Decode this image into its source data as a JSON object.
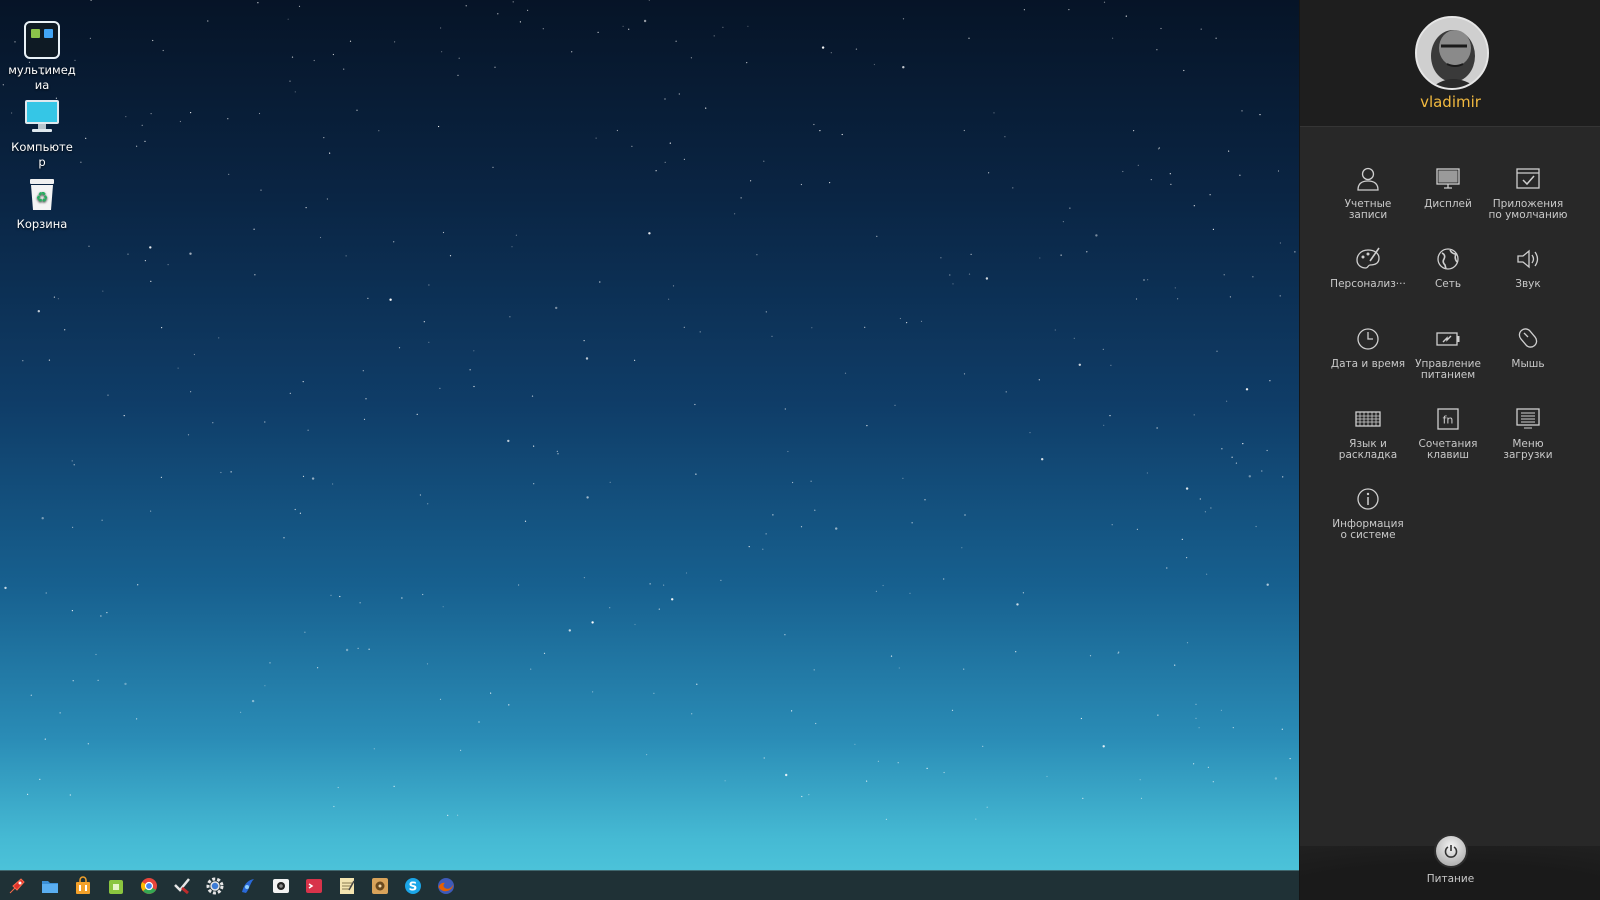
{
  "desktop": {
    "icons": [
      {
        "label": "мультимедиа",
        "icon": "multimedia-folder-icon"
      },
      {
        "label": "Компьютер",
        "icon": "computer-icon"
      },
      {
        "label": "Корзина",
        "icon": "trash-icon"
      }
    ]
  },
  "taskbar": {
    "items": [
      {
        "icon": "launcher-rocket-icon",
        "color": "#e0322c"
      },
      {
        "icon": "file-manager-icon",
        "color": "#3b8fd6"
      },
      {
        "icon": "store-icon",
        "color": "#f3a12a"
      },
      {
        "icon": "android-package-icon",
        "color": "#8ac53f"
      },
      {
        "icon": "chrome-icon",
        "color": "#e8453c"
      },
      {
        "icon": "task-tool-icon",
        "color": "#bd2c2c"
      },
      {
        "icon": "settings-gear-icon",
        "color": "#3a7bd5"
      },
      {
        "icon": "deepin-music-icon",
        "color": "#2a6ad9"
      },
      {
        "icon": "screenshot-icon",
        "color": "#ffffff"
      },
      {
        "icon": "terminal-icon",
        "color": "#d8334a"
      },
      {
        "icon": "text-editor-icon",
        "color": "#f3e4b0"
      },
      {
        "icon": "media-player-icon",
        "color": "#d9a35a"
      },
      {
        "icon": "skype-icon",
        "color": "#1ba6e8"
      },
      {
        "icon": "firefox-icon",
        "color": "#e66000"
      }
    ]
  },
  "panel": {
    "username": "vladimir",
    "items": [
      {
        "label": "Учетные\nзаписи",
        "icon": "user-accounts-icon"
      },
      {
        "label": "Дисплей",
        "icon": "display-icon"
      },
      {
        "label": "Приложения\nпо умолчанию",
        "icon": "default-apps-icon"
      },
      {
        "label": "Персонализ···",
        "icon": "personalization-icon"
      },
      {
        "label": "Сеть",
        "icon": "network-globe-icon"
      },
      {
        "label": "Звук",
        "icon": "sound-icon"
      },
      {
        "label": "Дата и время",
        "icon": "clock-icon"
      },
      {
        "label": "Управление\nпитанием",
        "icon": "power-management-icon"
      },
      {
        "label": "Мышь",
        "icon": "mouse-icon"
      },
      {
        "label": "Язык и\nраскладка",
        "icon": "keyboard-icon"
      },
      {
        "label": "Сочетания\nклавиш",
        "icon": "fn-key-icon"
      },
      {
        "label": "Меню\nзагрузки",
        "icon": "boot-menu-icon"
      },
      {
        "label": "Информация\nо системе",
        "icon": "info-icon"
      }
    ],
    "power_label": "Питание"
  },
  "colors": {
    "username": "#f1b93f",
    "panel_bg": "#282828",
    "taskbar_bg": "#1f3136"
  }
}
